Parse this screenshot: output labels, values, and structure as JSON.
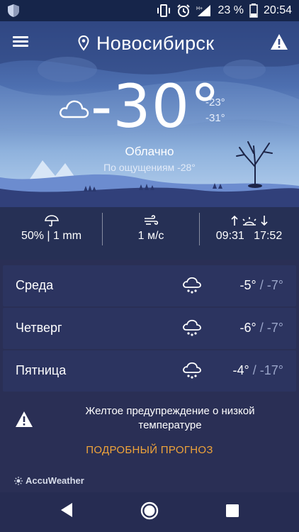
{
  "status_bar": {
    "battery": "23 %",
    "time": "20:54",
    "icons": [
      "shield-icon",
      "vibrate-icon",
      "alarm-icon",
      "signal-icon",
      "battery-icon"
    ]
  },
  "header": {
    "city": "Новосибирск",
    "icons": [
      "menu-icon",
      "location-pin-icon",
      "alert-icon"
    ]
  },
  "current": {
    "temperature": "-30°",
    "high": "-23°",
    "low": "-31°",
    "condition": "Облачно",
    "feels_like": "По ощущениям -28°",
    "icon": "cloud-icon"
  },
  "metrics": {
    "precipitation": {
      "icon": "umbrella-icon",
      "value": "50% | 1 mm"
    },
    "wind": {
      "icon": "wind-icon",
      "value": "1 м/с"
    },
    "sun": {
      "icon": "sunrise-sunset-icon",
      "sunrise": "09:31",
      "sunset": "17:52"
    }
  },
  "forecast": [
    {
      "day": "Среда",
      "icon": "snow-cloud-icon",
      "high": "-5°",
      "sep": "/",
      "low": "-7°"
    },
    {
      "day": "Четверг",
      "icon": "snow-cloud-icon",
      "high": "-6°",
      "sep": "/",
      "low": "-7°"
    },
    {
      "day": "Пятница",
      "icon": "snow-cloud-icon",
      "high": "-4°",
      "sep": "/",
      "low": "-17°"
    }
  ],
  "warning": {
    "icon": "warning-icon",
    "text": "Желтое предупреждение о низкой температуре"
  },
  "forecast_link": "ПОДРОБНЫЙ ПРОГНОЗ",
  "brand": "AccuWeather",
  "navbar": {
    "icons": [
      "back-icon",
      "home-icon",
      "recents-icon"
    ]
  },
  "colors": {
    "link": "#f0a43a",
    "background": "#2a2f55",
    "card": "#2c3460"
  }
}
